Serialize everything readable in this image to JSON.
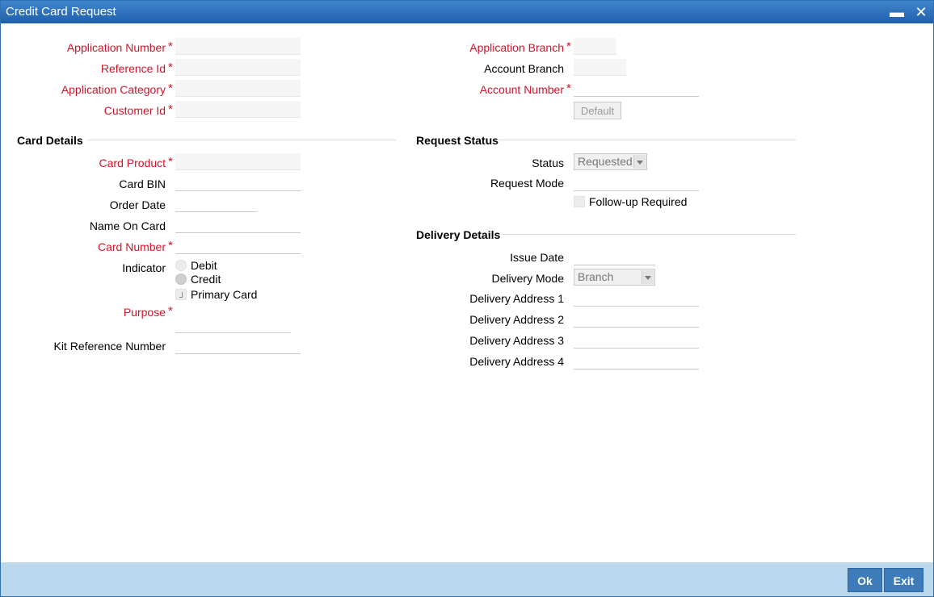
{
  "window": {
    "title": "Credit Card Request",
    "minimize_glyph": "▬",
    "close_glyph": "✕"
  },
  "header_fields": {
    "application_number": {
      "label": "Application Number",
      "value": ""
    },
    "reference_id": {
      "label": "Reference Id",
      "value": ""
    },
    "application_category": {
      "label": "Application Category",
      "value": ""
    },
    "customer_id": {
      "label": "Customer Id",
      "value": ""
    },
    "application_branch": {
      "label": "Application Branch",
      "value": ""
    },
    "account_branch": {
      "label": "Account Branch",
      "value": ""
    },
    "account_number": {
      "label": "Account Number",
      "value": ""
    },
    "default_button": "Default"
  },
  "card_details": {
    "heading": "Card Details",
    "card_product": {
      "label": "Card Product",
      "value": ""
    },
    "card_bin": {
      "label": "Card BIN",
      "value": ""
    },
    "order_date": {
      "label": "Order Date",
      "value": ""
    },
    "name_on_card": {
      "label": "Name On Card",
      "value": ""
    },
    "card_number": {
      "label": "Card Number",
      "value": ""
    },
    "indicator": {
      "label": "Indicator",
      "options": [
        "Debit",
        "Credit"
      ],
      "selected": "Credit"
    },
    "primary_card": {
      "label": "Primary Card",
      "checked": true
    },
    "purpose": {
      "label": "Purpose",
      "value": ""
    },
    "kit_reference_number": {
      "label": "Kit Reference Number",
      "value": ""
    }
  },
  "request_status": {
    "heading": "Request Status",
    "status": {
      "label": "Status",
      "value": "Requested"
    },
    "request_mode": {
      "label": "Request Mode",
      "value": ""
    },
    "follow_up": {
      "label": "Follow-up Required",
      "checked": false
    }
  },
  "delivery_details": {
    "heading": "Delivery Details",
    "issue_date": {
      "label": "Issue Date",
      "value": ""
    },
    "delivery_mode": {
      "label": "Delivery Mode",
      "value": "Branch"
    },
    "address1": {
      "label": "Delivery Address 1",
      "value": ""
    },
    "address2": {
      "label": "Delivery Address 2",
      "value": ""
    },
    "address3": {
      "label": "Delivery Address 3",
      "value": ""
    },
    "address4": {
      "label": "Delivery Address 4",
      "value": ""
    }
  },
  "footer": {
    "ok_label": "Ok",
    "exit_label": "Exit"
  },
  "colors": {
    "mandatory": "#d0142a",
    "titlebar": "#2f6fb0",
    "footer": "#bcd8ee",
    "button": "#3d7cb9"
  }
}
